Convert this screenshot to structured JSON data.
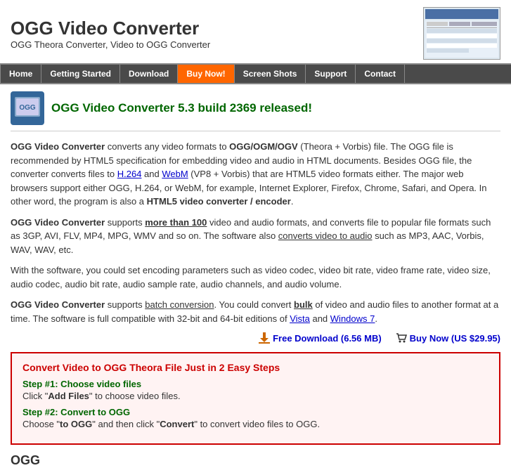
{
  "header": {
    "title": "OGG Video Converter",
    "subtitle": "OGG Theora Converter, Video to OGG Converter"
  },
  "nav": {
    "items": [
      {
        "label": "Home",
        "active": false,
        "buy": false
      },
      {
        "label": "Getting Started",
        "active": false,
        "buy": false
      },
      {
        "label": "Download",
        "active": false,
        "buy": false
      },
      {
        "label": "Buy Now!",
        "active": false,
        "buy": true
      },
      {
        "label": "Screen Shots",
        "active": false,
        "buy": false
      },
      {
        "label": "Support",
        "active": false,
        "buy": false
      },
      {
        "label": "Contact",
        "active": false,
        "buy": false
      }
    ]
  },
  "release": {
    "title": "OGG Video Converter 5.3 build 2369 released!"
  },
  "content": {
    "para1_parts": {
      "intro": "OGG Video Converter",
      "text1": " converts any video formats to ",
      "ogg_ogm_ogv": "OGG/OGM/OGV",
      "text2": " (Theora + Vorbis) file. The OGG file is recommended by HTML5 specification for embedding video and audio in HTML documents. Besides OGG file, the converter converts files to ",
      "h264": "H.264",
      "text3": " and ",
      "webm": "WebM",
      "text4": " (VP8 + Vorbis) that are HTML5 video formats either. The major web browsers support either OGG, H.264, or WebM, for example, Internet Explorer, Firefox, Chrome, Safari, and Opera. In other word, the program is also a ",
      "html5": "HTML5 video converter / encoder",
      "text5": "."
    },
    "para2_parts": {
      "intro": "OGG Video Converter",
      "text1": " supports ",
      "more_than_100": "more than 100",
      "text2": " video and audio formats, and converts file to popular file formats such as 3GP, AVI, FLV, MP4, MPG, WMV and so on. The software also ",
      "converts": "converts video to audio",
      "text3": " such as MP3, AAC, Vorbis, WAV, WAV, etc."
    },
    "para3": "With the software, you could set encoding parameters such as video codec, video bit rate, video frame rate, video size, audio codec, audio bit rate, audio sample rate, audio channels, and audio volume.",
    "para4_parts": {
      "intro": "OGG Video Converter",
      "text1": " supports ",
      "batch": "batch conversion",
      "text2": ". You could convert ",
      "bulk": "bulk",
      "text3": " of video and audio files to another format at a time. The software is full compatible with 32-bit and 64-bit editions of ",
      "vista": "Vista",
      "text4": " and ",
      "win7": "Windows 7",
      "text5": "."
    }
  },
  "download_links": {
    "free": "Free Download (6.56 MB)",
    "buy": "Buy Now (US $29.95)"
  },
  "easy_steps": {
    "heading": "Convert Video to OGG Theora File Just in 2 Easy Steps",
    "step1_title": "Step #1: Choose video files",
    "step1_desc_prefix": "Click \"",
    "step1_bold": "Add Files",
    "step1_desc_suffix": "\" to choose video files.",
    "step2_title": "Step #2: Convert to OGG",
    "step2_desc_prefix": "Choose \"",
    "step2_to_ogg": "to OGG",
    "step2_desc_mid": "\" and then click \"",
    "step2_convert": "Convert",
    "step2_desc_suffix": "\" to convert video files to OGG."
  },
  "ogg_section": {
    "title": "OGG"
  }
}
